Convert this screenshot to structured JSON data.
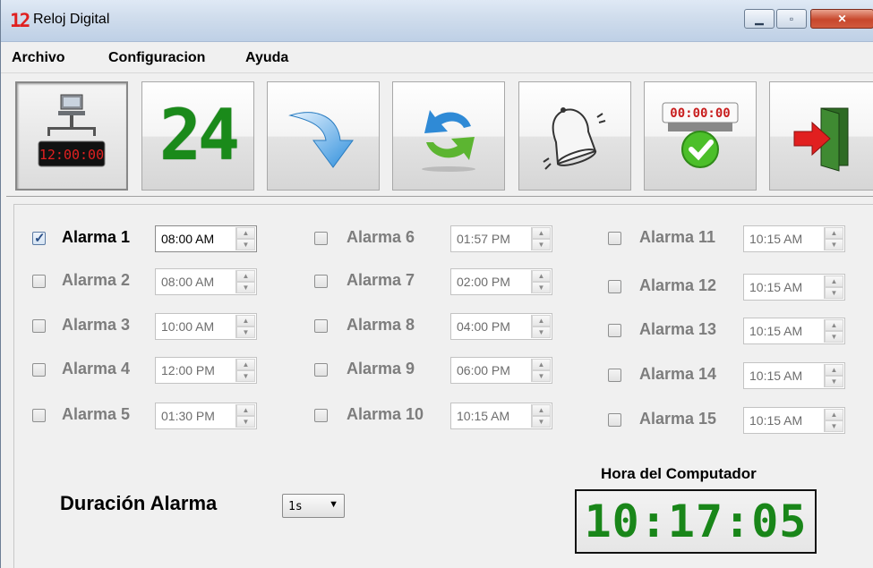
{
  "window": {
    "title": "Reloj Digital",
    "icon_text": "12",
    "icon_color": "#e02020",
    "controls": {
      "minimize": "minimize-icon",
      "maximize": "maximize-icon",
      "close": "close-icon"
    }
  },
  "menu": [
    {
      "label": "Archivo"
    },
    {
      "label": "Configuracion"
    },
    {
      "label": "Ayuda"
    }
  ],
  "toolbar": {
    "buttons": [
      {
        "icon": "computer-clock-icon",
        "clock_text": "12:00:00",
        "pressed": true
      },
      {
        "icon": "24-hour-icon",
        "text": "24"
      },
      {
        "icon": "arrow-down-icon"
      },
      {
        "icon": "sync-arrows-icon"
      },
      {
        "icon": "bell-icon"
      },
      {
        "icon": "timer-check-icon",
        "timer_text": "00:00:00"
      },
      {
        "icon": "exit-door-icon"
      }
    ]
  },
  "alarms": [
    {
      "label": "Alarma 1",
      "time": "08:00 AM",
      "checked": true
    },
    {
      "label": "Alarma 2",
      "time": "08:00 AM",
      "checked": false
    },
    {
      "label": "Alarma 3",
      "time": "10:00 AM",
      "checked": false
    },
    {
      "label": "Alarma 4",
      "time": "12:00 PM",
      "checked": false
    },
    {
      "label": "Alarma 5",
      "time": "01:30 PM",
      "checked": false
    },
    {
      "label": "Alarma 6",
      "time": "01:57 PM",
      "checked": false
    },
    {
      "label": "Alarma 7",
      "time": "02:00 PM",
      "checked": false
    },
    {
      "label": "Alarma 8",
      "time": "04:00 PM",
      "checked": false
    },
    {
      "label": "Alarma 9",
      "time": "06:00 PM",
      "checked": false
    },
    {
      "label": "Alarma 10",
      "time": "10:15 AM",
      "checked": false
    },
    {
      "label": "Alarma 11",
      "time": "10:15 AM",
      "checked": false
    },
    {
      "label": "Alarma 12",
      "time": "10:15 AM",
      "checked": false
    },
    {
      "label": "Alarma 13",
      "time": "10:15 AM",
      "checked": false
    },
    {
      "label": "Alarma 14",
      "time": "10:15 AM",
      "checked": false
    },
    {
      "label": "Alarma 15",
      "time": "10:15 AM",
      "checked": false
    }
  ],
  "duration": {
    "label": "Duración Alarma",
    "value": "1s"
  },
  "computer_time": {
    "label": "Hora del Computador",
    "value": "10:17:05",
    "color": "#198619"
  }
}
